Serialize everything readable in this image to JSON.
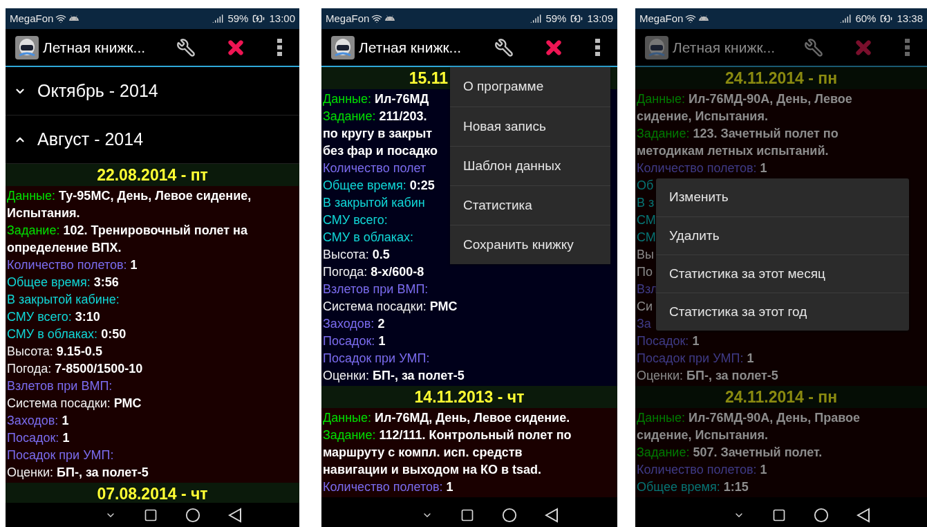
{
  "screens": [
    {
      "status_bar": {
        "carrier": "MegaFon",
        "battery": "59%",
        "time": "13:00"
      },
      "app_bar": {
        "title": "Летная книжк..."
      },
      "dimmed": false,
      "groups": [
        {
          "title": "Октябрь - 2014",
          "expanded": false
        },
        {
          "title": "Август - 2014",
          "expanded": true
        }
      ],
      "entries": [
        {
          "date": "22.08.2014 - пт",
          "color": "#1a0000",
          "clipped": false,
          "fields": [
            {
              "kind": "task",
              "label": "Данные:",
              "value": "Ту-95МС, День, Левое сидение,"
            },
            {
              "kind": "continuation",
              "value": "Испытания."
            },
            {
              "kind": "task",
              "label": "Задание:",
              "value": "102. Тренировочный полет на"
            },
            {
              "kind": "continuation",
              "value": "определение ВПХ."
            },
            {
              "kind": "count",
              "label": "Количество полетов:",
              "value": "1"
            },
            {
              "kind": "time",
              "label": "Общее время:",
              "value": "3:56"
            },
            {
              "kind": "time",
              "label": "В закрытой кабине:"
            },
            {
              "kind": "time",
              "label": "СМУ всего:",
              "value": "3:10"
            },
            {
              "kind": "time",
              "label": "СМУ в облаках:",
              "value": "0:50"
            },
            {
              "kind": "info",
              "label": "Высота:",
              "value": "9.15-0.5"
            },
            {
              "kind": "info",
              "label": "Погода:",
              "value": "7-8500/1500-10"
            },
            {
              "kind": "count",
              "label": "Взлетов при ВМП:"
            },
            {
              "kind": "info",
              "label": "Система посадки:",
              "value": "РМС"
            },
            {
              "kind": "count",
              "label": "Заходов:",
              "value": "1"
            },
            {
              "kind": "count",
              "label": "Посадок:",
              "value": "1"
            },
            {
              "kind": "count",
              "label": "Посадок при УМП:"
            },
            {
              "kind": "info",
              "label": "Оценки:",
              "value": "БП-, за полет-5"
            }
          ]
        },
        {
          "date": "07.08.2014 - чт",
          "clipped": false
        }
      ]
    },
    {
      "status_bar": {
        "carrier": "MegaFon",
        "battery": "59%",
        "time": "13:09"
      },
      "app_bar": {
        "title": "Летная книжк..."
      },
      "dimmed": false,
      "entries": [
        {
          "date": "15.11",
          "color": "#00001a",
          "clipped": true,
          "fields": [
            {
              "kind": "task",
              "label": "Данные:",
              "value": "Ил-76МД"
            },
            {
              "kind": "task",
              "label": "Задание:",
              "value": "211/203."
            },
            {
              "kind": "continuation",
              "value": "по кругу в закрыт"
            },
            {
              "kind": "continuation",
              "value": "без фар и посадко"
            },
            {
              "kind": "count",
              "label": "Количество полет"
            },
            {
              "kind": "time",
              "label": "Общее время:",
              "value": "0:25"
            },
            {
              "kind": "time",
              "label": "В закрытой кабин"
            },
            {
              "kind": "time",
              "label": "СМУ всего:"
            },
            {
              "kind": "time",
              "label": "СМУ в облаках:"
            },
            {
              "kind": "info",
              "label": "Высота:",
              "value": "0.5"
            },
            {
              "kind": "info",
              "label": "Погода:",
              "value": "8-х/600-8"
            },
            {
              "kind": "count",
              "label": "Взлетов при ВМП:"
            },
            {
              "kind": "info",
              "label": "Система посадки:",
              "value": "РМС"
            },
            {
              "kind": "count",
              "label": "Заходов:",
              "value": "2"
            },
            {
              "kind": "count",
              "label": "Посадок:",
              "value": "1"
            },
            {
              "kind": "count",
              "label": "Посадок при УМП:"
            },
            {
              "kind": "info",
              "label": "Оценки:",
              "value": "БП-, за полет-5"
            }
          ]
        },
        {
          "date": "14.11.2013 - чт",
          "color": "#1a0000",
          "clipped": false,
          "fields": [
            {
              "kind": "task",
              "label": "Данные:",
              "value": "Ил-76МД, День, Левое сидение."
            },
            {
              "kind": "task",
              "label": "Задание:",
              "value": "112/111. Контрольный полет по"
            },
            {
              "kind": "continuation",
              "value": "маршруту с компл. исп. средств"
            },
            {
              "kind": "continuation",
              "value": "навигации и выходом на КО в tsad."
            },
            {
              "kind": "count",
              "label": "Количество полетов:",
              "value": "1"
            }
          ]
        }
      ],
      "menu": {
        "kind": "dropdown",
        "items": [
          "О программе",
          "Новая запись",
          "Шаблон данных",
          "Статистика",
          "Сохранить книжку"
        ]
      }
    },
    {
      "status_bar": {
        "carrier": "MegaFon",
        "battery": "60%",
        "time": "13:38"
      },
      "app_bar": {
        "title": "Летная книжк..."
      },
      "dimmed": true,
      "entries": [
        {
          "date": "24.11.2014 - пн",
          "color": "#0d0000",
          "clipped": false,
          "fields": [
            {
              "kind": "task",
              "label": "Данные:",
              "value": "Ил-76МД-90А, День, Левое"
            },
            {
              "kind": "continuation",
              "value": "сидение, Испытания."
            },
            {
              "kind": "task",
              "label": "Задание:",
              "value": "123. Зачетный полет по"
            },
            {
              "kind": "continuation",
              "value": "методикам летных испытаний."
            },
            {
              "kind": "count",
              "label": "Количество полетов:",
              "value": "1"
            },
            {
              "kind": "time",
              "label": "Об"
            },
            {
              "kind": "time",
              "label": "В з"
            },
            {
              "kind": "time",
              "label": "СМ"
            },
            {
              "kind": "time",
              "label": "СМ"
            },
            {
              "kind": "info",
              "label": "Вы"
            },
            {
              "kind": "info",
              "label": "По"
            },
            {
              "kind": "count",
              "label": "Взл"
            },
            {
              "kind": "info",
              "label": "Си"
            },
            {
              "kind": "count",
              "label": "За"
            },
            {
              "kind": "count",
              "label": "Посадок:",
              "value": "1"
            },
            {
              "kind": "count",
              "label": "Посадок при УМП:",
              "value": "1"
            },
            {
              "kind": "info",
              "label": "Оценки:",
              "value": "БП-, за полет-5"
            }
          ]
        },
        {
          "date": "24.11.2014 - пн",
          "color": "#0d0000",
          "clipped": false,
          "fields": [
            {
              "kind": "task",
              "label": "Данные:",
              "value": "Ил-76МД-90А, День, Правое"
            },
            {
              "kind": "continuation",
              "value": "сидение, Испытания."
            },
            {
              "kind": "task",
              "label": "Задание:",
              "value": "507. Зачетный полет."
            },
            {
              "kind": "count",
              "label": "Количество полетов:",
              "value": "1"
            },
            {
              "kind": "time",
              "label": "Общее время:",
              "value": "1:15"
            }
          ]
        }
      ],
      "menu": {
        "kind": "context",
        "items": [
          "Изменить",
          "Удалить",
          "Статистика за этот месяц",
          "Статистика за этот год"
        ]
      }
    }
  ]
}
